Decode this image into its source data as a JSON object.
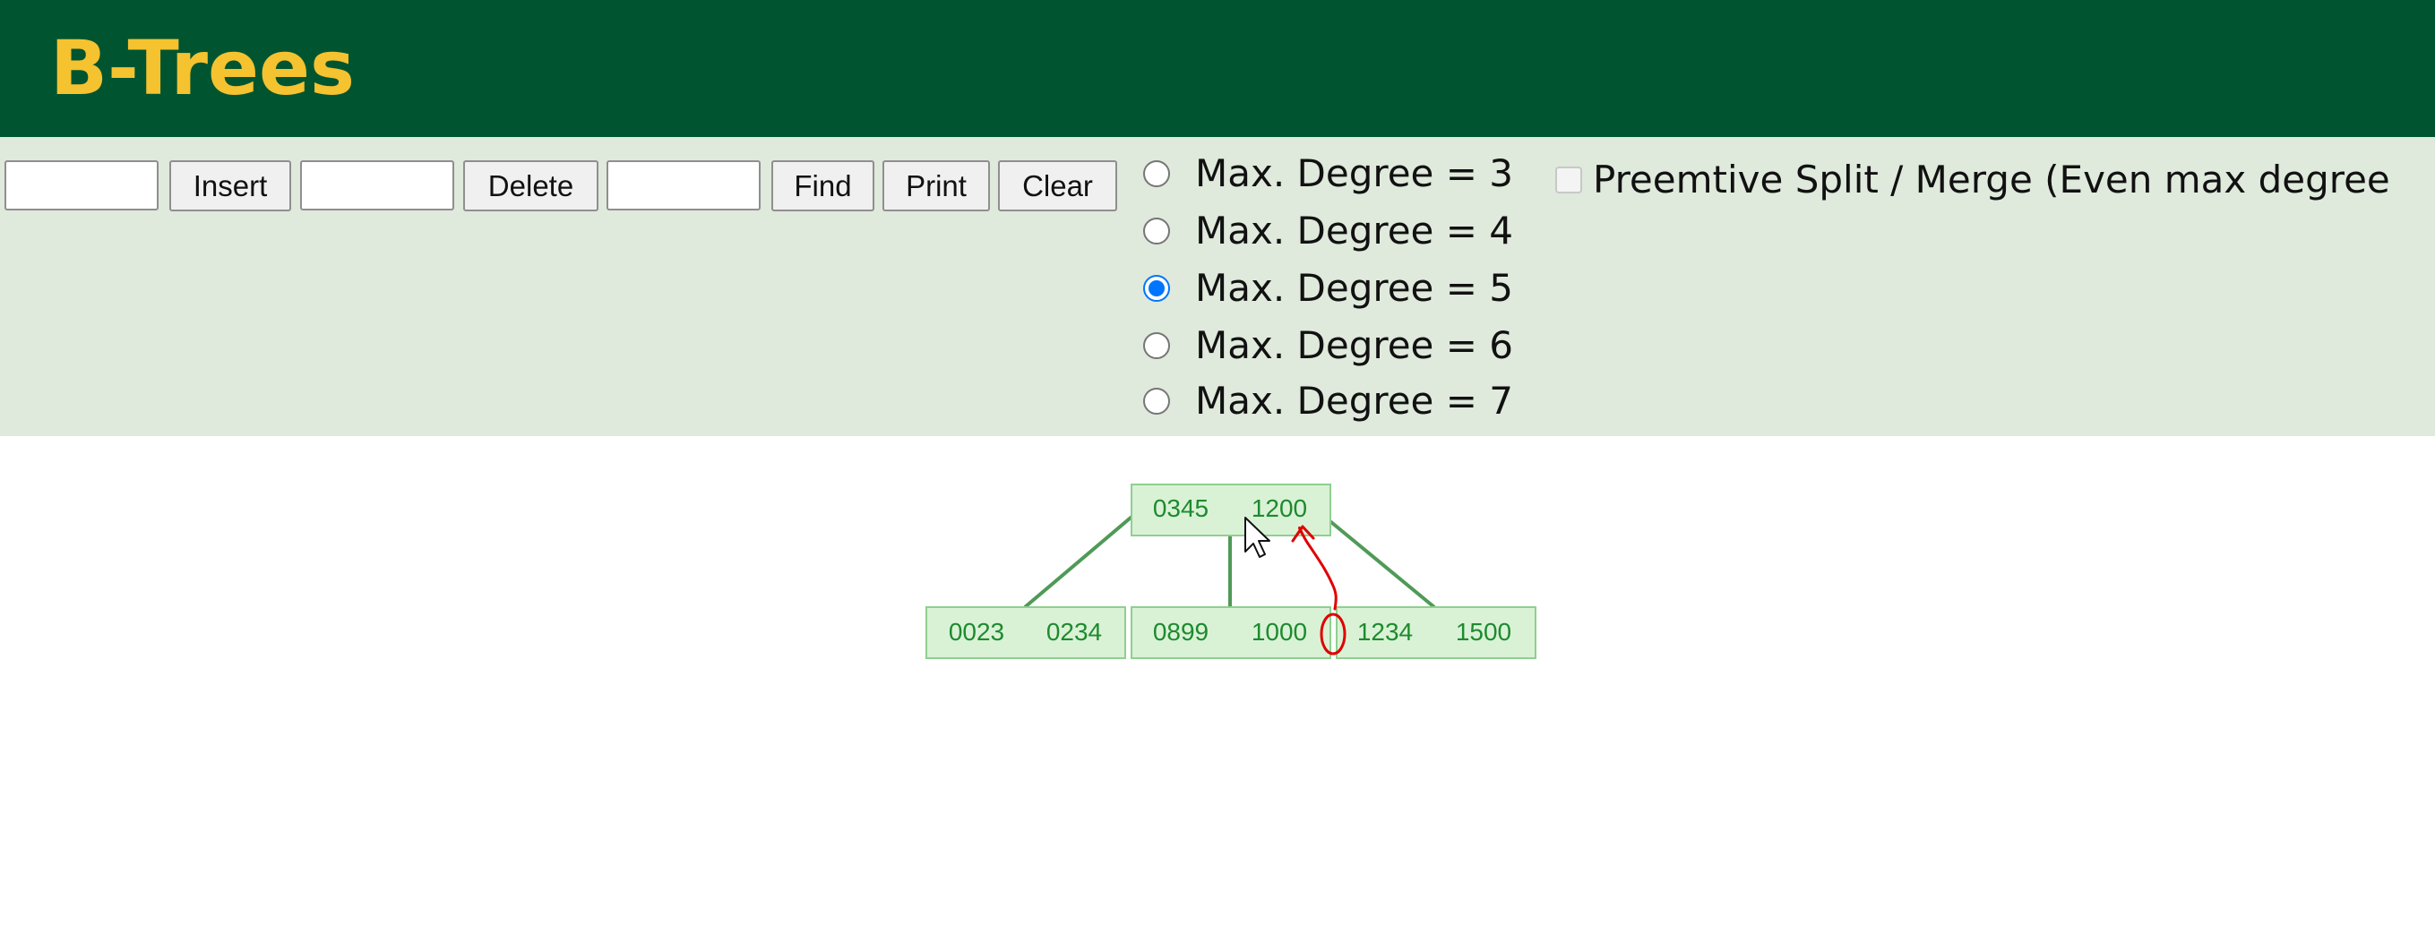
{
  "header": {
    "title": "B-Trees"
  },
  "toolbar": {
    "insert_input": {
      "value": "",
      "placeholder": ""
    },
    "insert_label": "Insert",
    "delete_input": {
      "value": "",
      "placeholder": ""
    },
    "delete_label": "Delete",
    "find_input": {
      "value": "",
      "placeholder": ""
    },
    "find_label": "Find",
    "print_label": "Print",
    "clear_label": "Clear"
  },
  "degree_options": [
    {
      "label": "Max. Degree = 3",
      "checked": false
    },
    {
      "label": "Max. Degree = 4",
      "checked": false
    },
    {
      "label": "Max. Degree = 5",
      "checked": true
    },
    {
      "label": "Max. Degree = 6",
      "checked": false
    },
    {
      "label": "Max. Degree = 7",
      "checked": false
    }
  ],
  "preemptive": {
    "label": "Preemtive Split / Merge (Even max degree",
    "checked": false,
    "enabled": false
  },
  "tree": {
    "root": {
      "keys": [
        "0345",
        "1200"
      ]
    },
    "children": [
      {
        "keys": [
          "0023",
          "0234"
        ]
      },
      {
        "keys": [
          "0899",
          "1000"
        ]
      },
      {
        "keys": [
          "1234",
          "1500"
        ]
      }
    ]
  },
  "colors": {
    "header_bg": "#005530",
    "title": "#f5c230",
    "controls_bg": "#dfe9dc",
    "node_fill": "#d9f2d6",
    "node_stroke": "#8fcf8f",
    "edge": "#4f9a57",
    "key_text": "#1e8a2e",
    "annotation": "#e00000",
    "radio_selected": "#0075ff"
  }
}
